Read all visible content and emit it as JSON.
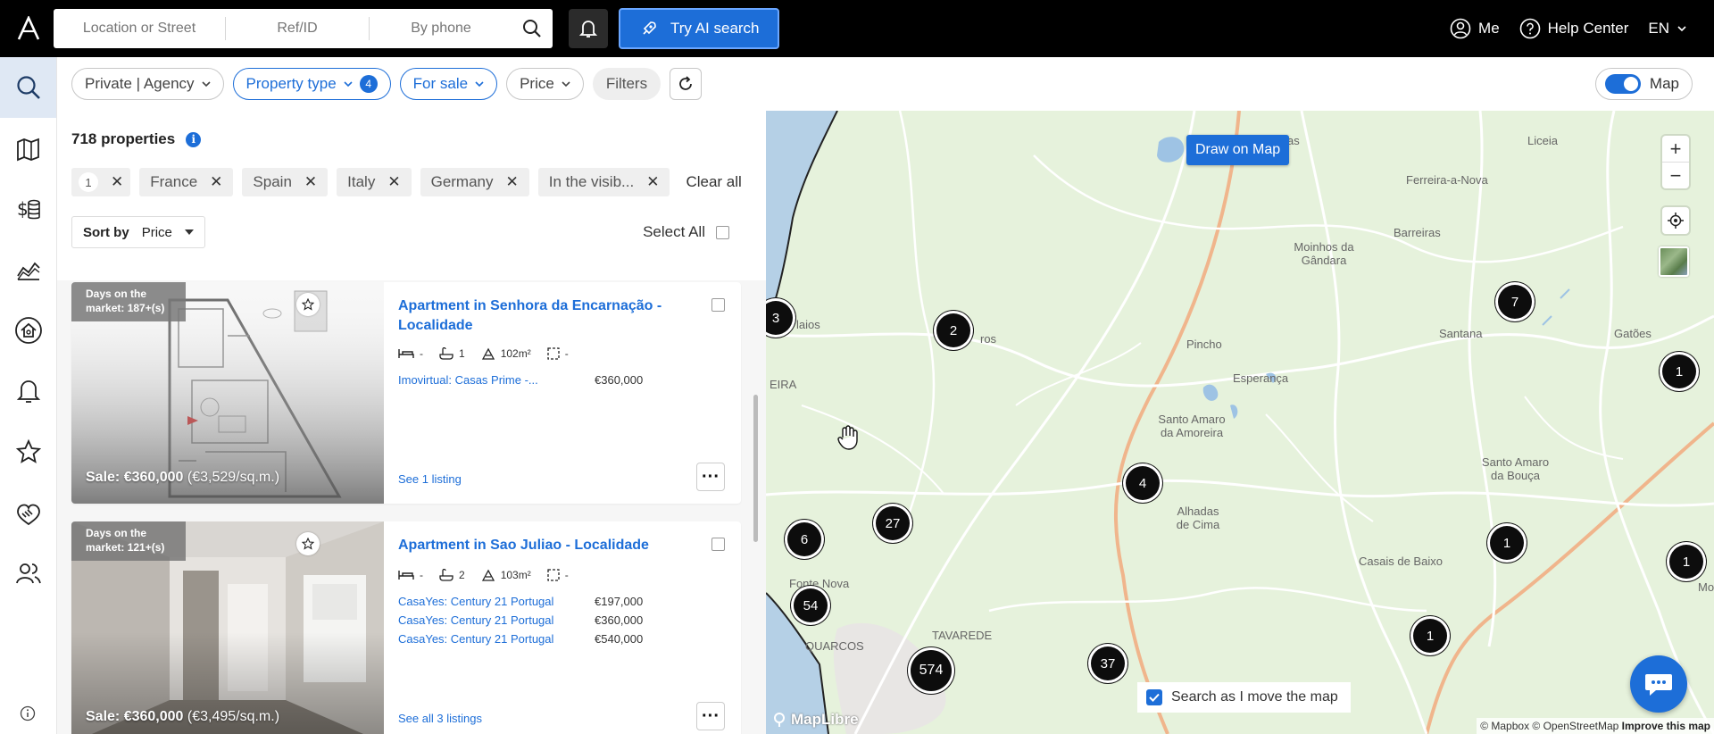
{
  "search": {
    "location_placeholder": "Location or Street",
    "ref_placeholder": "Ref/ID",
    "phone_placeholder": "By phone"
  },
  "top": {
    "ai_search": "Try AI search",
    "me": "Me",
    "help": "Help Center",
    "lang": "EN"
  },
  "filters": {
    "owner": "Private | Agency",
    "property_type": "Property type",
    "property_type_count": "4",
    "sale": "For sale",
    "price": "Price",
    "more": "Filters",
    "map": "Map"
  },
  "list": {
    "count": "718 properties",
    "tags": [
      {
        "label": "1"
      },
      {
        "label": "France"
      },
      {
        "label": "Spain"
      },
      {
        "label": "Italy"
      },
      {
        "label": "Germany"
      },
      {
        "label": "In the visib..."
      }
    ],
    "clear_all": "Clear all",
    "sort_by": "Sort by",
    "sort_value": "Price",
    "select_all": "Select All"
  },
  "cards": [
    {
      "days": "Days on the market: 187+(s)",
      "sale": "Sale: €360,000",
      "per_sqm": "(€3,529/sq.m.)",
      "title": "Apartment in Senhora da Encarnação - Localidade",
      "beds": "-",
      "baths": "1",
      "area": "102m²",
      "rooms": "-",
      "listings": [
        {
          "source": "Imovirtual: Casas Prime -...",
          "price": "€360,000"
        }
      ],
      "see": "See 1 listing"
    },
    {
      "days": "Days on the market: 121+(s)",
      "sale": "Sale: €360,000",
      "per_sqm": "(€3,495/sq.m.)",
      "title": "Apartment in Sao Juliao - Localidade",
      "beds": "-",
      "baths": "2",
      "area": "103m²",
      "rooms": "-",
      "listings": [
        {
          "source": "CasaYes: Century 21 Portugal",
          "price": "€197,000"
        },
        {
          "source": "CasaYes: Century 21 Portugal",
          "price": "€360,000"
        },
        {
          "source": "CasaYes: Century 21 Portugal",
          "price": "€540,000"
        }
      ],
      "see": "See all 3 listings"
    }
  ],
  "map": {
    "draw": "Draw on Map",
    "search_move": "Search as I move the map",
    "maplibre": "MapLibre",
    "attribution": "© Mapbox © OpenStreetMap",
    "improve": "Improve this map",
    "places": {
      "queridas": "Queridas",
      "liceia": "Liceia",
      "ferreira": "Ferreira-a-Nova",
      "barreiras": "Barreiras",
      "moinhos": "Moinhos da Gândara",
      "santana": "Santana",
      "gatoes": "Gatões",
      "pincho": "Pincho",
      "esperanca": "Esperança",
      "santo_amaro_amoreira": "Santo Amaro da Amoreira",
      "santo_amaro_bouca": "Santo Amaro da Bouça",
      "alhadas": "Alhadas de Cima",
      "casais": "Casais de Baixo",
      "fonte_nova": "Fonte Nova",
      "tavarede": "TAVAREDE",
      "quarcos": "QUARCOS",
      "eira": "EIRA",
      "laios": "laios",
      "ros": "ros",
      "mo": "Mo"
    },
    "clusters": [
      "3",
      "2",
      "7",
      "1",
      "4",
      "27",
      "6",
      "1",
      "1",
      "54",
      "1",
      "574",
      "37"
    ]
  }
}
